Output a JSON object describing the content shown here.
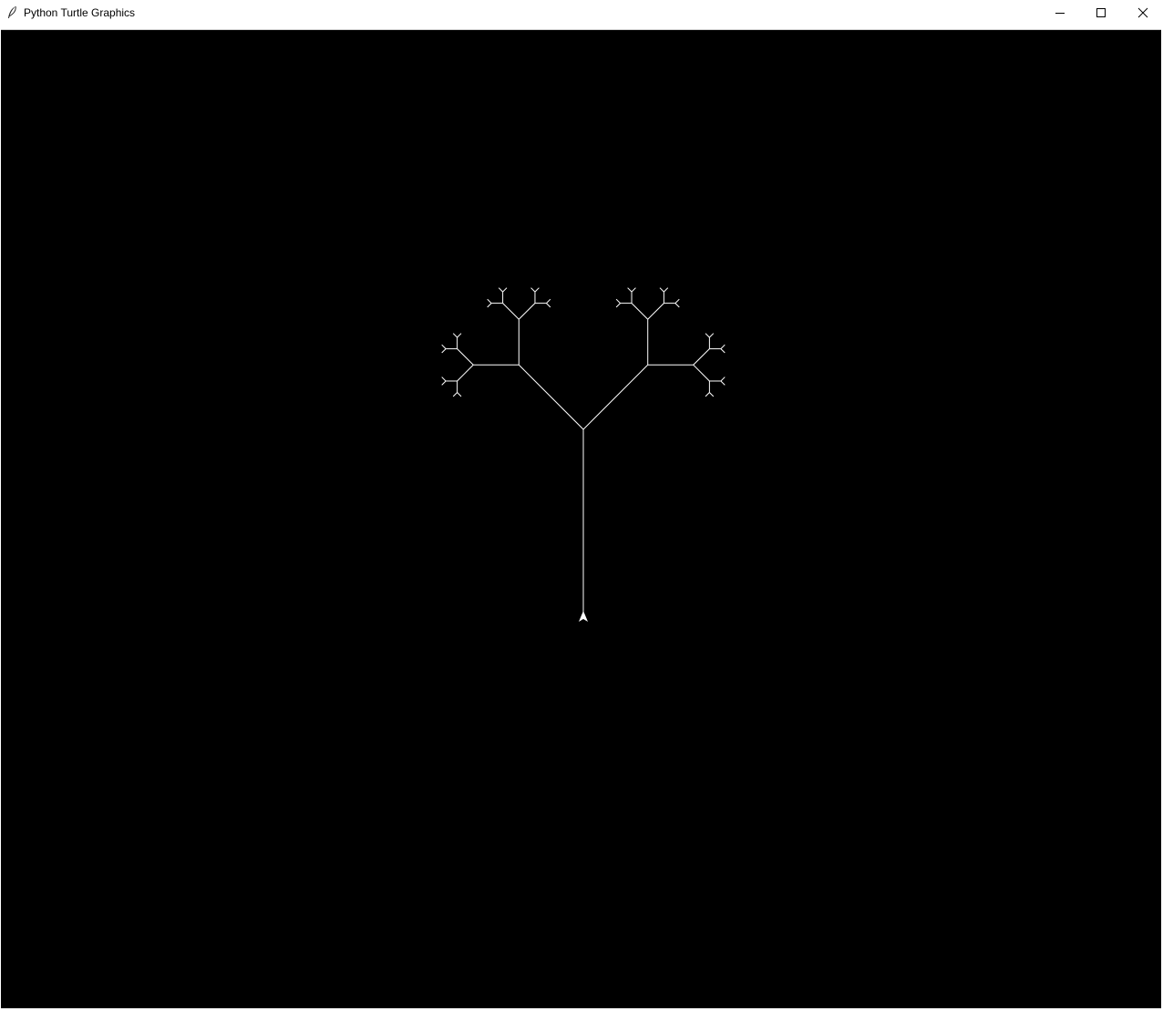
{
  "window": {
    "title": "Python Turtle Graphics",
    "icons": {
      "app": "feather-icon",
      "minimize": "minimize-icon",
      "maximize": "maximize-icon",
      "close": "close-icon"
    }
  },
  "canvas": {
    "background_color": "#000000",
    "pen_color": "#ffffff",
    "turtle_icon": "turtle-arrow-icon",
    "drawing": "fractal-tree"
  }
}
